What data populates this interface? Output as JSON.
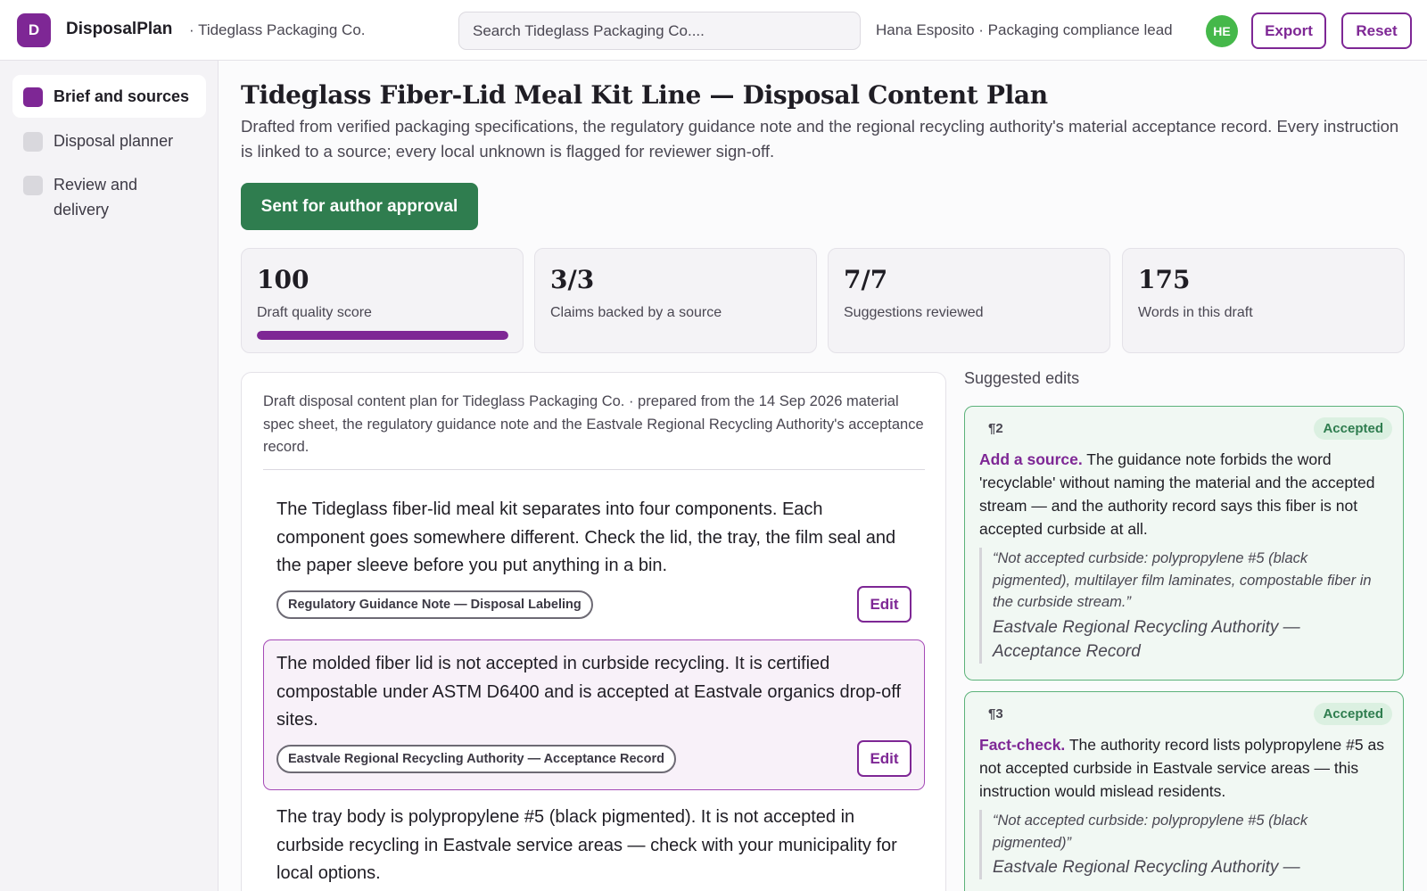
{
  "header": {
    "logo_letter": "D",
    "app_name": "DisposalPlan",
    "org": "· Tideglass Packaging Co.",
    "search_placeholder": "Search Tideglass Packaging Co....",
    "user": "Hana Esposito · Packaging compliance lead",
    "avatar_initials": "HE",
    "export_label": "Export",
    "reset_label": "Reset"
  },
  "sidebar": {
    "items": [
      {
        "label": "Brief and sources",
        "active": true
      },
      {
        "label": "Disposal planner",
        "active": false
      },
      {
        "label": "Review and delivery",
        "active": false
      }
    ]
  },
  "page": {
    "title": "Tideglass Fiber-Lid Meal Kit Line — Disposal Content Plan",
    "subtitle": "Drafted from verified packaging specifications, the regulatory guidance note and the regional recycling authority's material acceptance record. Every instruction is linked to a source; every local unknown is flagged for reviewer sign-off.",
    "status_button": "Sent for author approval"
  },
  "stats": [
    {
      "value": "100",
      "label": "Draft quality score",
      "progress": 1.0
    },
    {
      "value": "3/3",
      "label": "Claims backed by a source"
    },
    {
      "value": "7/7",
      "label": "Suggestions reviewed"
    },
    {
      "value": "175",
      "label": "Words in this draft"
    }
  ],
  "draft": {
    "meta": "Draft disposal content plan for Tideglass Packaging Co. · prepared from the 14 Sep 2026 material spec sheet, the regulatory guidance note and the Eastvale Regional Recycling Authority's acceptance record.",
    "edit_label": "Edit",
    "paragraphs": [
      {
        "text": "The Tideglass fiber-lid meal kit separates into four components. Each component goes somewhere different. Check the lid, the tray, the film seal and the paper sleeve before you put anything in a bin.",
        "source": "Regulatory Guidance Note — Disposal Labeling"
      },
      {
        "text": "The molded fiber lid is not accepted in curbside recycling. It is certified compostable under ASTM D6400 and is accepted at Eastvale organics drop-off sites.",
        "source": "Eastvale Regional Recycling Authority — Acceptance Record"
      },
      {
        "text": "The tray body is polypropylene #5 (black pigmented). It is not accepted in curbside recycling in Eastvale service areas — check with your municipality for local options."
      }
    ]
  },
  "suggestions": {
    "title": "Suggested edits",
    "items": [
      {
        "para": "¶2",
        "status": "Accepted",
        "kind": "Add a source.",
        "body": " The guidance note forbids the word 'recyclable' without naming the material and the accepted stream — and the authority record says this fiber is not accepted curbside at all.",
        "quote": "“Not accepted curbside: polypropylene #5 (black pigmented), multilayer film laminates, compostable fiber in the curbside stream.”",
        "source": "Eastvale Regional Recycling Authority — Acceptance Record"
      },
      {
        "para": "¶3",
        "status": "Accepted",
        "kind": "Fact-check.",
        "body": " The authority record lists polypropylene #5 as not accepted curbside in Eastvale service areas — this instruction would mislead residents.",
        "quote": "“Not accepted curbside: polypropylene #5 (black pigmented)”",
        "source": "Eastvale Regional Recycling Authority —"
      }
    ]
  },
  "colors": {
    "brand": "#7e2795",
    "success": "#2f7d4f",
    "avatar": "#45b84a"
  }
}
